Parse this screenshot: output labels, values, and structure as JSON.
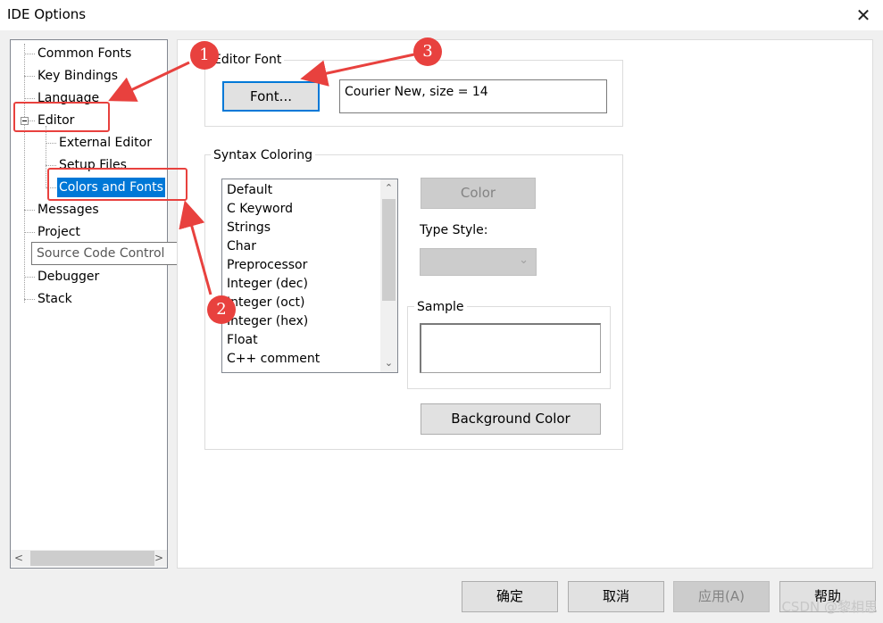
{
  "window": {
    "title": "IDE Options",
    "close_glyph": "✕"
  },
  "tree": {
    "items": [
      {
        "label": "Common Fonts"
      },
      {
        "label": "Key Bindings"
      },
      {
        "label": "Language"
      },
      {
        "label": "Editor"
      },
      {
        "label": "External Editor"
      },
      {
        "label": "Setup Files"
      },
      {
        "label": "Colors and Fonts",
        "selected": true
      },
      {
        "label": "Messages"
      },
      {
        "label": "Project"
      },
      {
        "label": "Debugger"
      },
      {
        "label": "Stack"
      }
    ],
    "tooltip": "Source Code Control"
  },
  "editor_font": {
    "group_label": "Editor Font",
    "font_button": "Font...",
    "font_value": "Courier New, size = 14"
  },
  "syntax": {
    "group_label": "Syntax Coloring",
    "items": [
      "Default",
      "C Keyword",
      "Strings",
      "Char",
      "Preprocessor",
      "Integer (dec)",
      "Integer (oct)",
      "Integer (hex)",
      "Float",
      "C++ comment"
    ],
    "color_button": "Color",
    "type_style_label": "Type Style:",
    "sample_label": "Sample",
    "background_button": "Background Color"
  },
  "footer": {
    "ok": "确定",
    "cancel": "取消",
    "apply": "应用(A)",
    "help": "帮助"
  },
  "annotations": {
    "callouts": [
      "1",
      "2",
      "3"
    ],
    "color": "#e8413e"
  },
  "watermark": "CSDN @黎相思"
}
